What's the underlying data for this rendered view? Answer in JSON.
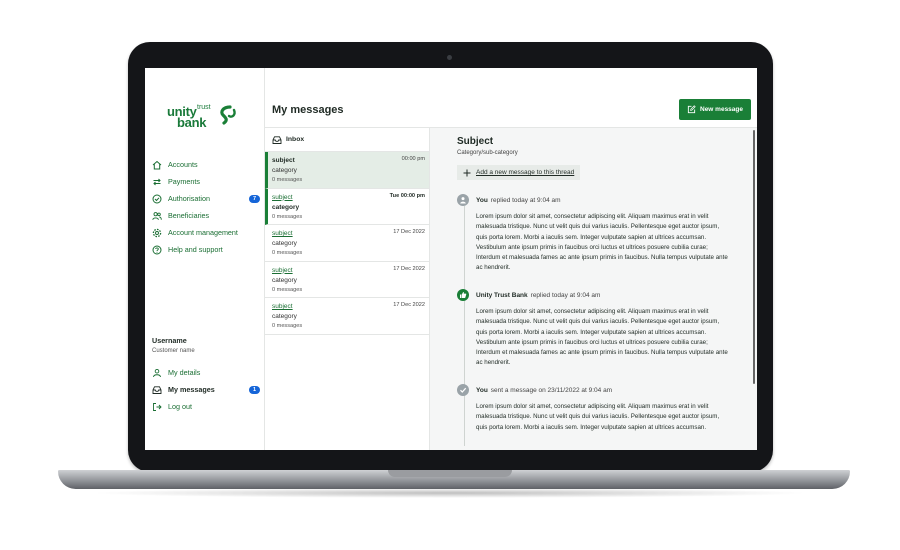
{
  "brand": {
    "logo_line1": "unity",
    "logo_small": "trust",
    "logo_line2": "bank"
  },
  "sidebar": {
    "items": [
      {
        "label": "Accounts",
        "icon": "home-icon"
      },
      {
        "label": "Payments",
        "icon": "transfer-icon"
      },
      {
        "label": "Authorisation",
        "icon": "check-circle-icon",
        "badge": "7"
      },
      {
        "label": "Beneficiaries",
        "icon": "people-icon"
      },
      {
        "label": "Account management",
        "icon": "gear-icon"
      },
      {
        "label": "Help and support",
        "icon": "question-icon"
      }
    ],
    "username": "Username",
    "customer_name": "Customer name",
    "user_items": [
      {
        "label": "My details",
        "icon": "person-icon"
      },
      {
        "label": "My messages",
        "icon": "inbox-icon",
        "badge": "1"
      },
      {
        "label": "Log out",
        "icon": "logout-icon"
      }
    ]
  },
  "header": {
    "title": "My messages",
    "new_message_label": "New message"
  },
  "list": {
    "inbox_label": "Inbox",
    "messages": [
      {
        "subject": "subject",
        "category": "category",
        "count": "0 messages",
        "date": "00:00 pm"
      },
      {
        "subject": "subject",
        "category": "category",
        "count": "0 messages",
        "date": "Tue 00:00 pm"
      },
      {
        "subject": "subject",
        "category": "category",
        "count": "0 messages",
        "date": "17 Dec 2022"
      },
      {
        "subject": "subject",
        "category": "category",
        "count": "0 messages",
        "date": "17 Dec 2022"
      },
      {
        "subject": "subject",
        "category": "category",
        "count": "0 messages",
        "date": "17 Dec 2022"
      }
    ]
  },
  "thread": {
    "subject": "Subject",
    "category": "Category/sub-category",
    "add_message_label": "Add a new message to this thread",
    "entries": [
      {
        "author": "You",
        "action": "replied today at 9:04 am",
        "body": "Lorem ipsum dolor sit amet, consectetur adipiscing elit. Aliquam maximus erat in velit malesuada tristique. Nunc ut velit quis dui varius iaculis. Pellentesque eget auctor ipsum, quis porta lorem. Morbi a iaculis sem. Integer vulputate sapien at ultrices accumsan. Vestibulum ante ipsum primis in faucibus orci luctus et ultrices posuere cubilia curae; Interdum et malesuada fames ac ante ipsum primis in faucibus. Nulla tempus vulputate ante ac hendrerit."
      },
      {
        "author": "Unity Trust Bank",
        "action": "replied today at 9:04 am",
        "body": "Lorem ipsum dolor sit amet, consectetur adipiscing elit. Aliquam maximus erat in velit malesuada tristique. Nunc ut velit quis dui varius iaculis. Pellentesque eget auctor ipsum, quis porta lorem. Morbi a iaculis sem. Integer vulputate sapien at ultrices accumsan. Vestibulum ante ipsum primis in faucibus orci luctus et ultrices posuere cubilia curae; Interdum et malesuada fames ac ante ipsum primis in faucibus. Nulla tempus vulputate ante ac hendrerit."
      },
      {
        "author": "You",
        "action": "sent a message on 23/11/2022 at 9:04 am",
        "body": "Lorem ipsum dolor sit amet, consectetur adipiscing elit. Aliquam maximus erat in velit malesuada tristique. Nunc ut velit quis dui varius iaculis. Pellentesque eget auctor ipsum, quis porta lorem. Morbi a iaculis sem. Integer vulputate sapien at ultrices accumsan."
      }
    ]
  },
  "colors": {
    "brand_green": "#1a7f37",
    "badge_blue": "#1565d8",
    "selected_bg": "#e4ede6"
  }
}
